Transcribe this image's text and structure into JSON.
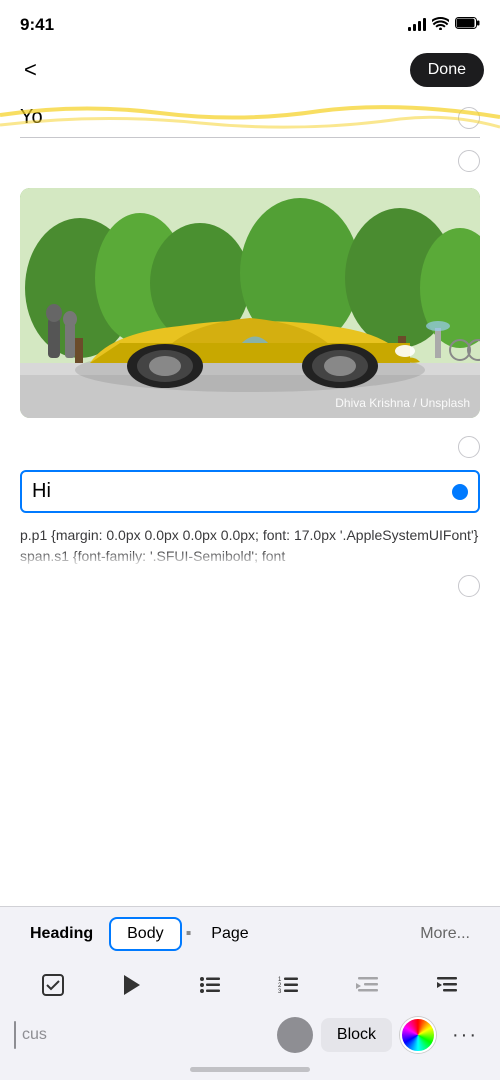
{
  "statusBar": {
    "time": "9:41"
  },
  "navBar": {
    "backLabel": "<",
    "doneLabel": "Done"
  },
  "document": {
    "textLine1": "Yo",
    "activeTextLine": "Hi",
    "codeText": "p.p1 {margin: 0.0px 0.0px 0.0px 0.0px; font: 17.0px '.AppleSystemUIFont'} span.s1 {font-family: '.SFUI-Semibold'; font",
    "imageCaption": "Dhiva Krishna / Unsplash"
  },
  "toolbar": {
    "tabs": [
      {
        "label": "Heading",
        "active": false,
        "bold": true
      },
      {
        "label": "Body",
        "active": true,
        "bold": false
      },
      {
        "label": "Page",
        "active": false,
        "bold": false
      },
      {
        "label": "More...",
        "active": false,
        "bold": false
      }
    ],
    "icons": [
      {
        "name": "checkbox",
        "symbol": "☑"
      },
      {
        "name": "play",
        "symbol": "▶"
      },
      {
        "name": "bullet-list",
        "symbol": "≡"
      },
      {
        "name": "numbered-list",
        "symbol": "⁽¹⁾"
      },
      {
        "name": "align-right",
        "symbol": "⬥"
      },
      {
        "name": "indent",
        "symbol": "⇥"
      }
    ],
    "focusLabel": "cus",
    "blockLabel": "Block",
    "moreLabel": "•••"
  }
}
